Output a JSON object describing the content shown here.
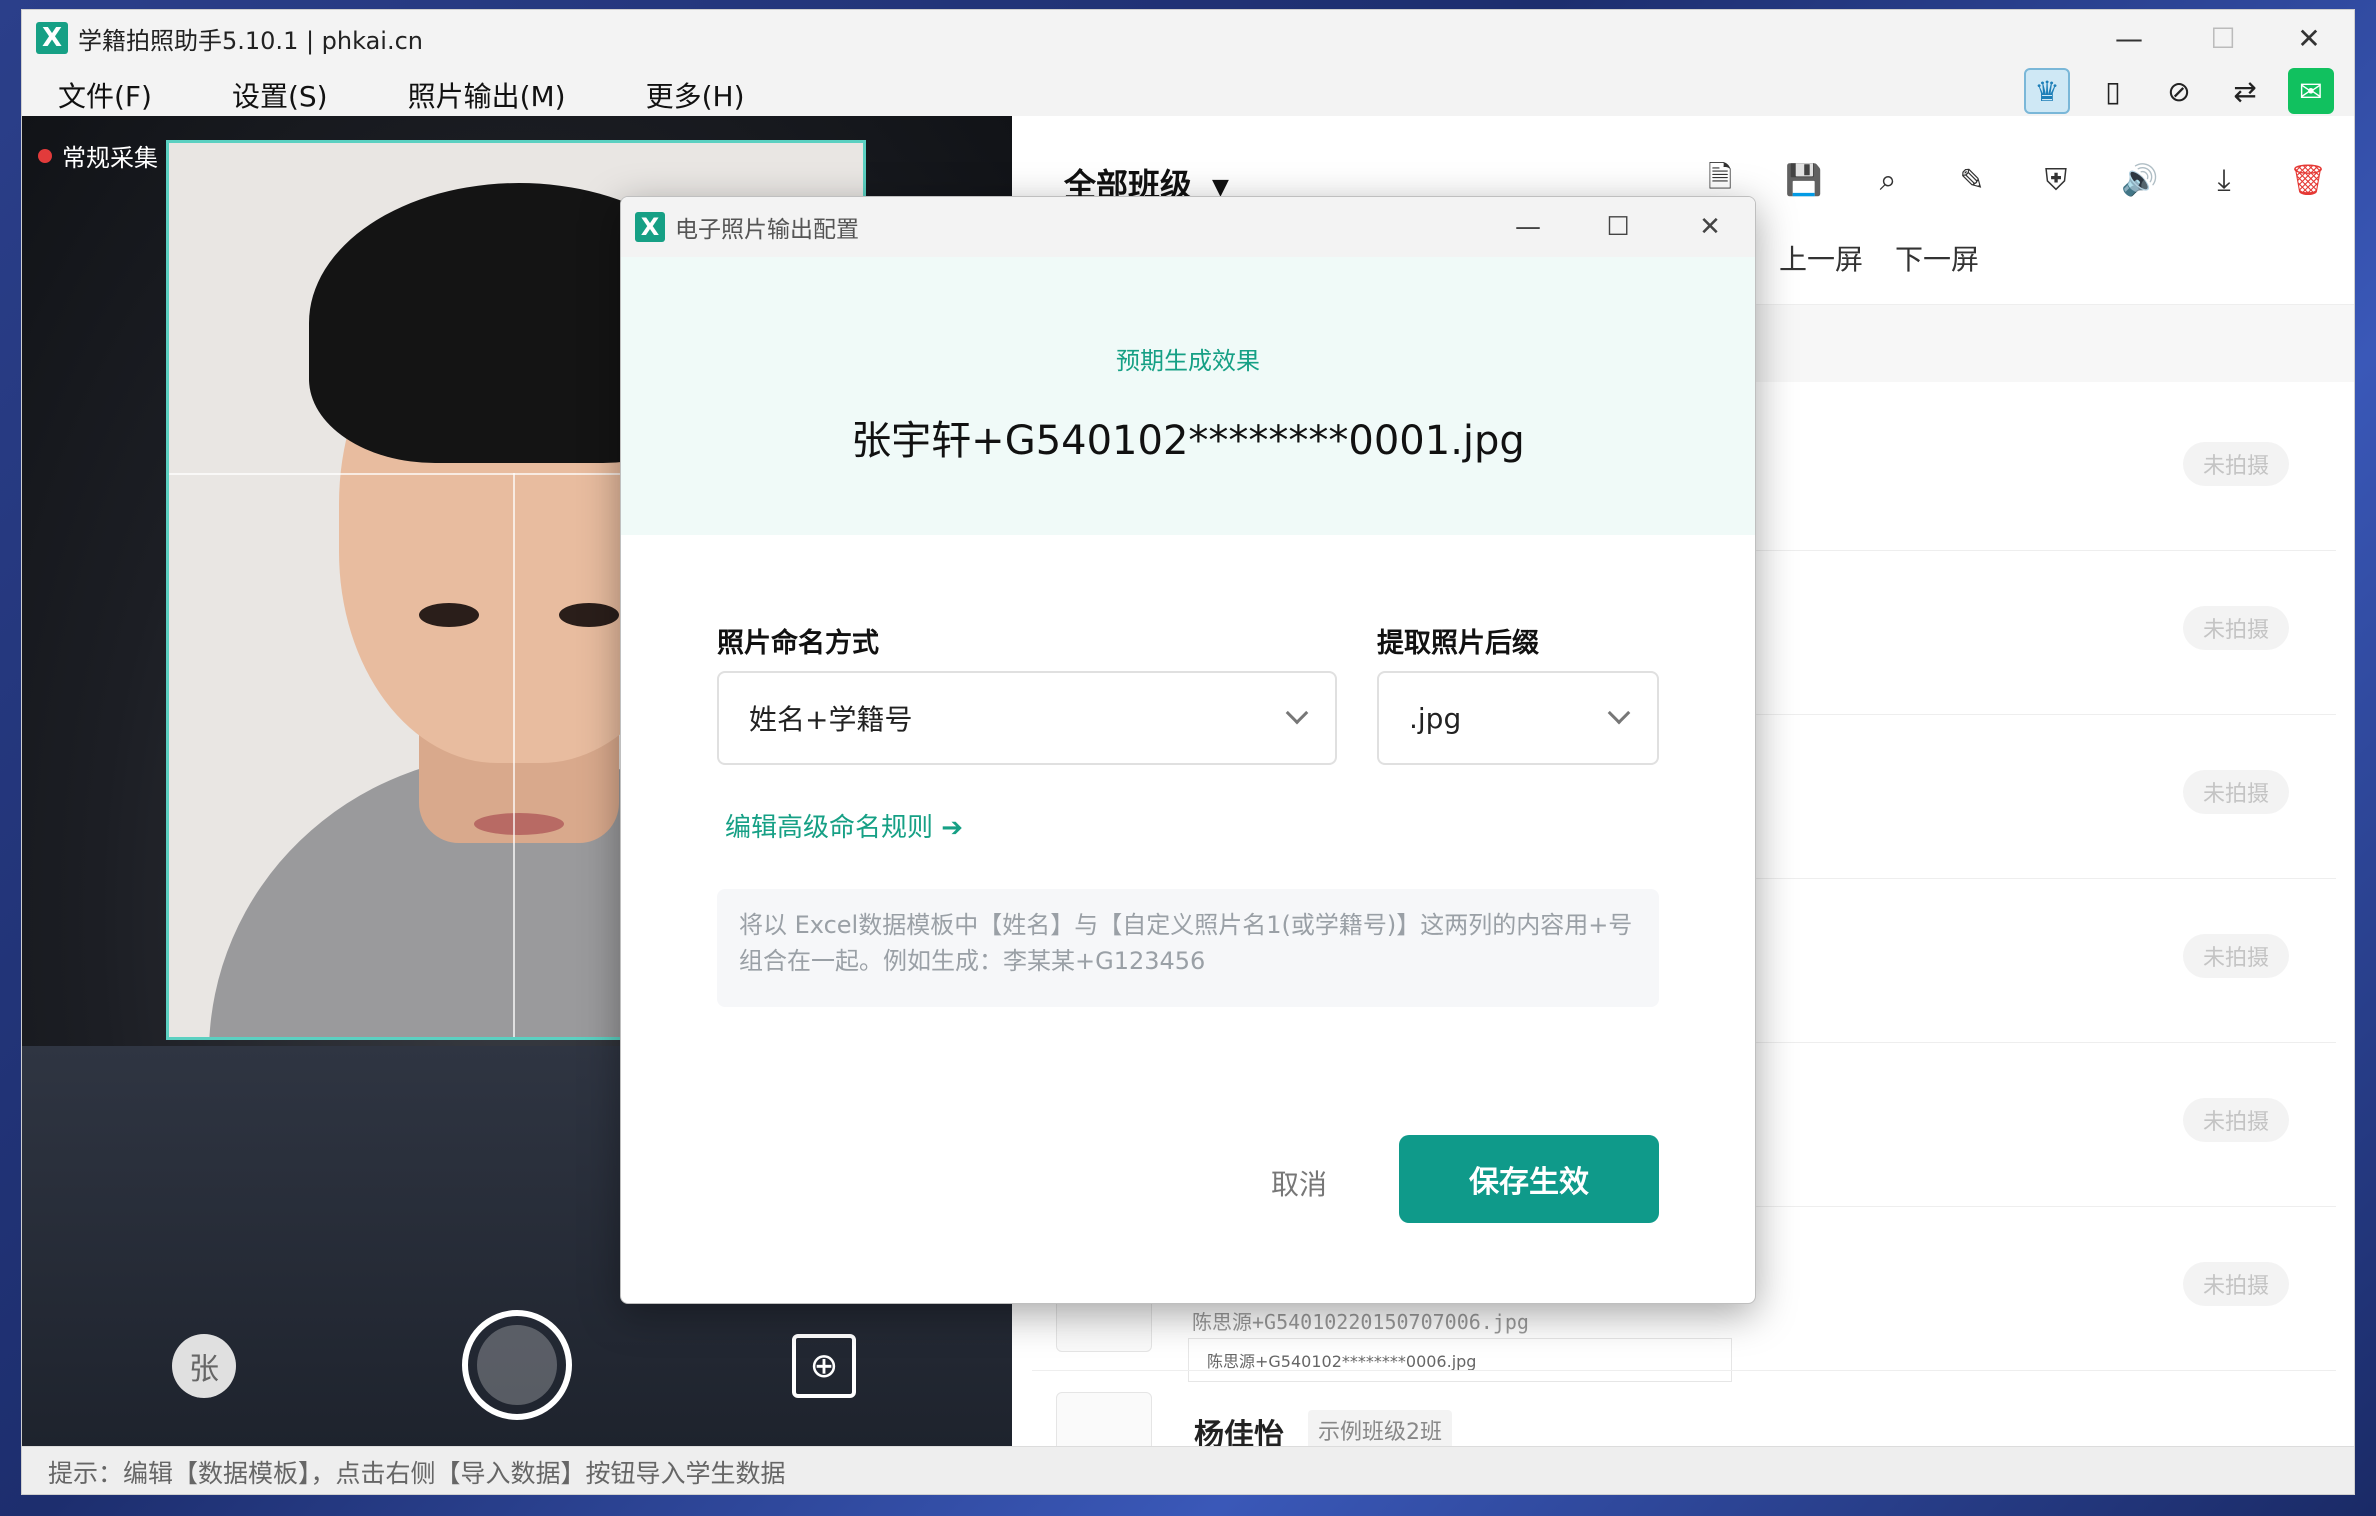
{
  "window": {
    "title": "学籍拍照助手5.10.1 | phkai.cn",
    "logo": "X",
    "min": "—",
    "max": "☐",
    "close": "✕"
  },
  "menu": {
    "items": [
      "文件(F)",
      "设置(S)",
      "照片输出(M)",
      "更多(H)"
    ]
  },
  "top_icons": [
    "crown-icon",
    "tablet-icon",
    "link-icon",
    "sync-icon",
    "wechat-icon"
  ],
  "camera": {
    "mode_label": "常规采集",
    "avatar_char": "张"
  },
  "right": {
    "class_select": "全部班级",
    "pager_prev": "上一屏",
    "pager_next": "下一屏",
    "status_label": "未拍摄",
    "file_line": "陈思源+G54010220150707006.jpg",
    "file_chip": "陈思源+G540102********0006.jpg",
    "student_name": "杨佳怡",
    "student_class": "示例班级2班"
  },
  "statusbar": {
    "hint": "提示：编辑【数据模板】，点击右侧【导入数据】按钮导入学生数据"
  },
  "dialog": {
    "title": "电子照片输出配置",
    "preview_label": "预期生成效果",
    "preview_file": "张宇轩+G540102********0001.jpg",
    "naming_label": "照片命名方式",
    "naming_value": "姓名+学籍号",
    "suffix_label": "提取照片后缀",
    "suffix_value": ".jpg",
    "adv_link": "编辑高级命名规则 ➔",
    "hint": "将以 Excel数据模板中【姓名】与【自定义照片名1(或学籍号)】这两列的内容用+号组合在一起。例如生成：李某某+G123456",
    "cancel": "取消",
    "save": "保存生效"
  }
}
